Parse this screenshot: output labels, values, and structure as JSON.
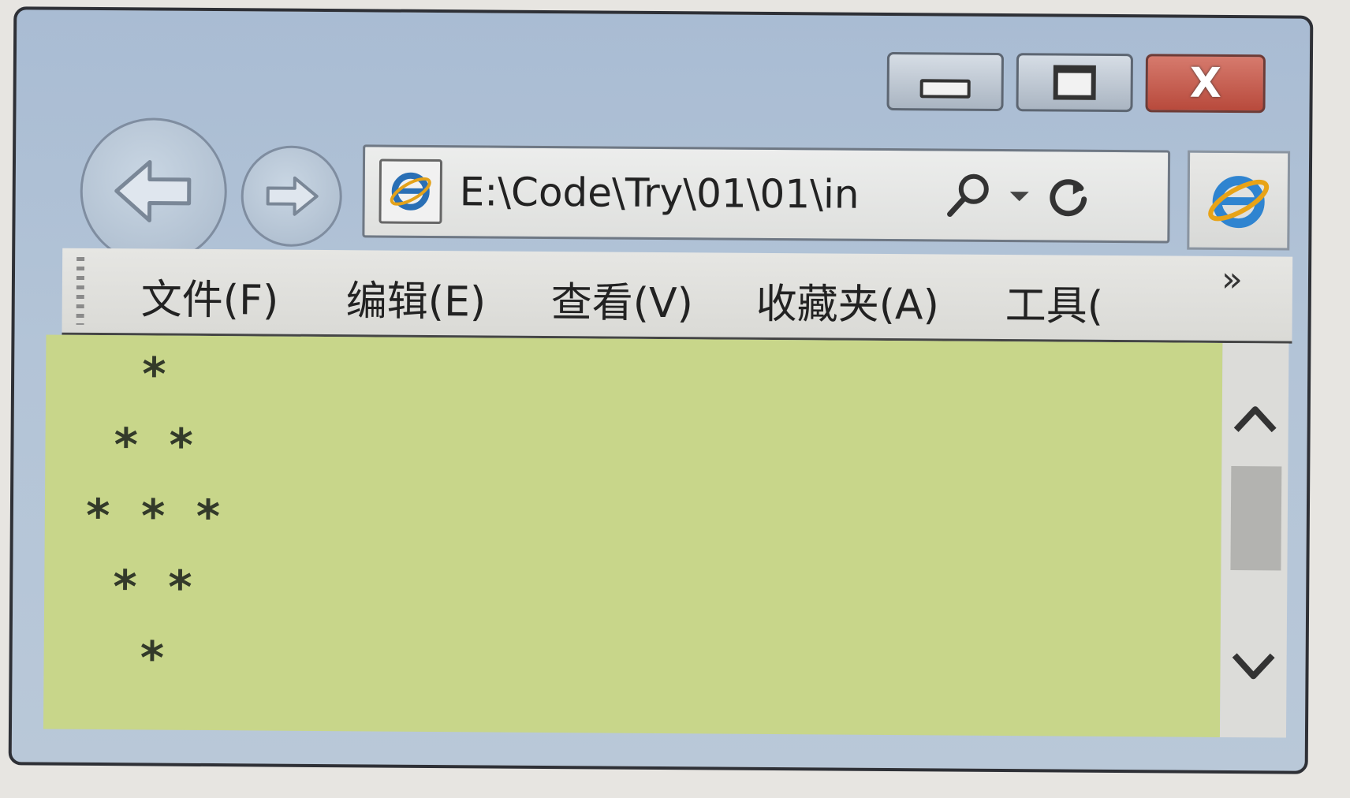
{
  "window": {
    "address_url": "E:\\Code\\Try\\01\\01\\in",
    "caption_buttons": {
      "minimize_icon": "minimize-icon",
      "maximize_icon": "maximize-icon",
      "close_label": "X"
    }
  },
  "menu": {
    "items": [
      {
        "label": "文件(F)"
      },
      {
        "label": "编辑(E)"
      },
      {
        "label": "查看(V)"
      },
      {
        "label": "收藏夹(A)"
      },
      {
        "label": "工具("
      }
    ],
    "overflow_label": "»"
  },
  "content": {
    "background_color": "#c8d68a",
    "lines": [
      "  *",
      " * *",
      "* * *",
      " * *",
      "  *"
    ]
  }
}
